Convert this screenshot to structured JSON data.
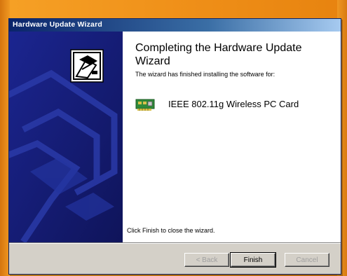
{
  "window": {
    "title": "Hardware Update Wizard"
  },
  "content": {
    "heading": "Completing the Hardware Update Wizard",
    "subtext": "The wizard has finished installing the software for:",
    "device_name": "IEEE 802.11g Wireless PC Card",
    "footer": "Click Finish to close the wizard."
  },
  "buttons": {
    "back_label": "< Back",
    "finish_label": "Finish",
    "cancel_label": "Cancel"
  },
  "icons": {
    "wizard": "hardware-wizard-icon",
    "device": "network-card-icon"
  },
  "colors": {
    "side_panel": "#141a6e",
    "titlebar": "#0a246a",
    "background": "#f0961e"
  }
}
